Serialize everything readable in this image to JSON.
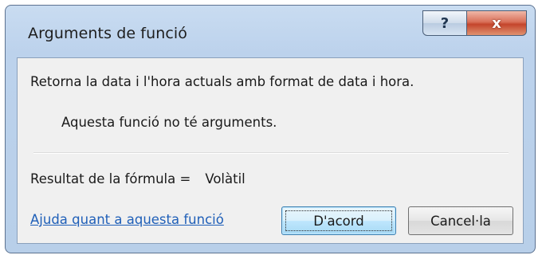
{
  "window": {
    "title": "Arguments de funció",
    "help_glyph": "?",
    "close_glyph": "x"
  },
  "dialog": {
    "description": "Retorna la data i l'hora actuals amb format de data i hora.",
    "no_arguments": "Aquesta funció no té arguments.",
    "result_label": "Resultat de la fórmula =",
    "result_value": "Volàtil",
    "help_link": "Ajuda quant a aquesta funció",
    "ok_label": "D'acord",
    "cancel_label": "Cancel·la"
  },
  "colors": {
    "frame": "#bcd2ec",
    "client": "#f0f0f0",
    "link": "#1f5fb8",
    "close_button": "#c4452c"
  }
}
